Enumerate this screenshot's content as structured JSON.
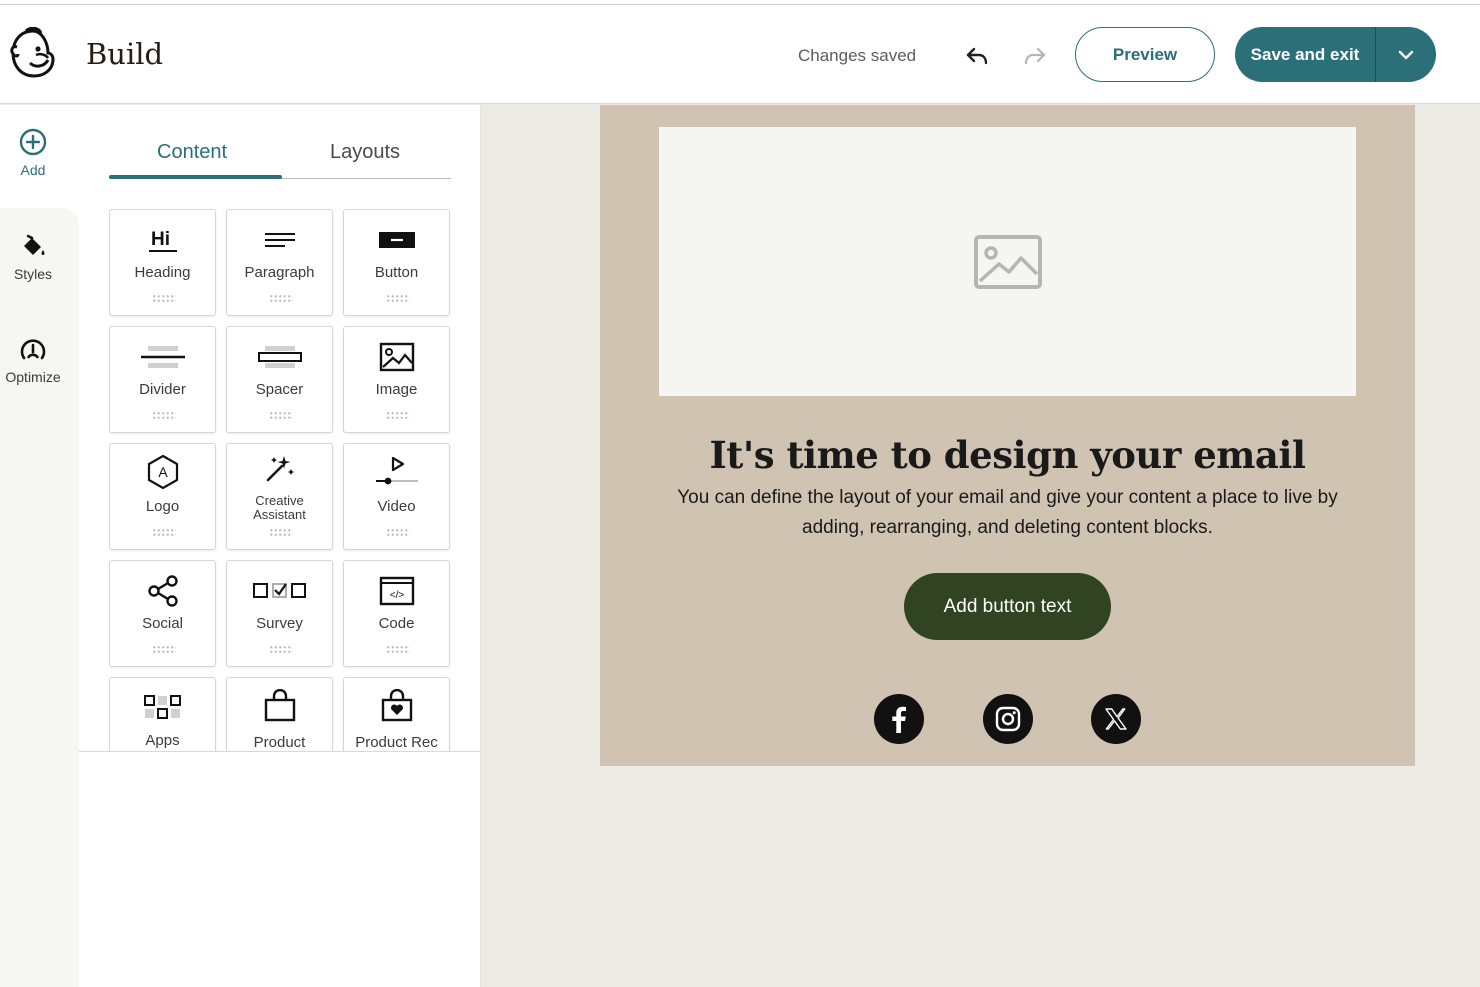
{
  "header": {
    "title": "Build",
    "status": "Changes saved",
    "preview_label": "Preview",
    "save_label": "Save and exit"
  },
  "rail": {
    "items": [
      {
        "label": "Add",
        "icon": "add-circle-icon"
      },
      {
        "label": "Styles",
        "icon": "paint-bucket-icon"
      },
      {
        "label": "Optimize",
        "icon": "gauge-icon"
      }
    ]
  },
  "panel": {
    "tabs": [
      {
        "label": "Content",
        "active": true
      },
      {
        "label": "Layouts",
        "active": false
      }
    ],
    "blocks": [
      {
        "label": "Heading",
        "icon": "heading-icon"
      },
      {
        "label": "Paragraph",
        "icon": "paragraph-icon"
      },
      {
        "label": "Button",
        "icon": "button-icon"
      },
      {
        "label": "Divider",
        "icon": "divider-icon"
      },
      {
        "label": "Spacer",
        "icon": "spacer-icon"
      },
      {
        "label": "Image",
        "icon": "image-icon"
      },
      {
        "label": "Logo",
        "icon": "logo-hexagon-icon"
      },
      {
        "label": "Creative Assistant",
        "icon": "magic-wand-icon"
      },
      {
        "label": "Video",
        "icon": "video-play-icon"
      },
      {
        "label": "Social",
        "icon": "share-icon"
      },
      {
        "label": "Survey",
        "icon": "survey-checkbox-icon"
      },
      {
        "label": "Code",
        "icon": "code-icon"
      },
      {
        "label": "Apps",
        "icon": "apps-icon"
      },
      {
        "label": "Product",
        "icon": "shopping-bag-icon"
      },
      {
        "label": "Product Rec",
        "icon": "shopping-bag-heart-icon"
      }
    ],
    "heading_glyph": "Hi",
    "logo_glyph": "A",
    "code_glyph": "</>"
  },
  "email": {
    "heading": "It's time to design your email",
    "body": "You can define the layout of your email and give your content a place to live by adding, rearranging, and deleting content blocks.",
    "button_label": "Add button text",
    "social": [
      "facebook-icon",
      "instagram-icon",
      "x-twitter-icon"
    ]
  },
  "colors": {
    "accent": "#2b6f79",
    "email_bg": "#d0c3b2",
    "cta_bg": "#314421",
    "canvas_bg": "#ebebe4"
  }
}
